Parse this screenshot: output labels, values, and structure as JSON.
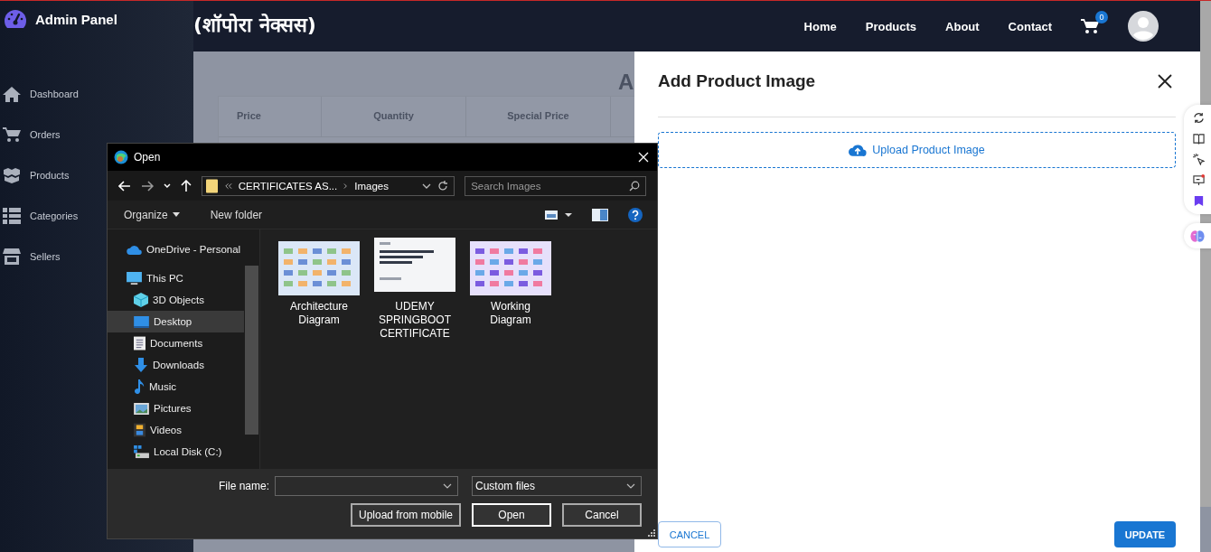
{
  "sidebar": {
    "title": "Admin Panel",
    "items": [
      {
        "label": "Dashboard",
        "kind": "home"
      },
      {
        "label": "Orders",
        "kind": "cart"
      },
      {
        "label": "Products",
        "kind": "boxes"
      },
      {
        "label": "Categories",
        "kind": "list"
      },
      {
        "label": "Sellers",
        "kind": "store"
      }
    ]
  },
  "header": {
    "brand": "(शॉपोरा नेक्सस)",
    "nav": [
      "Home",
      "Products",
      "About",
      "Contact"
    ],
    "cart_count": "0"
  },
  "page": {
    "heading": "A",
    "columns": [
      "Price",
      "Quantity",
      "Special Price"
    ]
  },
  "drawer": {
    "title": "Add Product Image",
    "upload_label": "Upload Product Image",
    "cancel": "CANCEL",
    "update": "UPDATE"
  },
  "dialog": {
    "title": "Open",
    "path": [
      "CERTIFICATES AS...",
      "Images"
    ],
    "search_placeholder": "Search Images",
    "organize": "Organize",
    "new_folder": "New folder",
    "tree": [
      {
        "label": "OneDrive - Personal",
        "kind": "cloud",
        "selected": false
      },
      {
        "label": "This PC",
        "kind": "pc",
        "selected": false,
        "children": [
          {
            "label": "3D Objects",
            "kind": "cube",
            "selected": false
          },
          {
            "label": "Desktop",
            "kind": "desktop",
            "selected": true
          },
          {
            "label": "Documents",
            "kind": "doc",
            "selected": false
          },
          {
            "label": "Downloads",
            "kind": "download",
            "selected": false
          },
          {
            "label": "Music",
            "kind": "music",
            "selected": false
          },
          {
            "label": "Pictures",
            "kind": "pictures",
            "selected": false
          },
          {
            "label": "Videos",
            "kind": "videos",
            "selected": false
          },
          {
            "label": "Local Disk (C:)",
            "kind": "disk",
            "selected": false
          }
        ]
      }
    ],
    "files": [
      {
        "name": "Architecture Diagram",
        "kind": "picture"
      },
      {
        "name": "UDEMY SPRINGBOOT CERTIFICATE",
        "kind": "picture"
      },
      {
        "name": "Working Diagram",
        "kind": "picture"
      }
    ],
    "file_name_label": "File name:",
    "file_type": "Custom files",
    "buttons": [
      "Upload from mobile",
      "Open",
      "Cancel"
    ]
  }
}
